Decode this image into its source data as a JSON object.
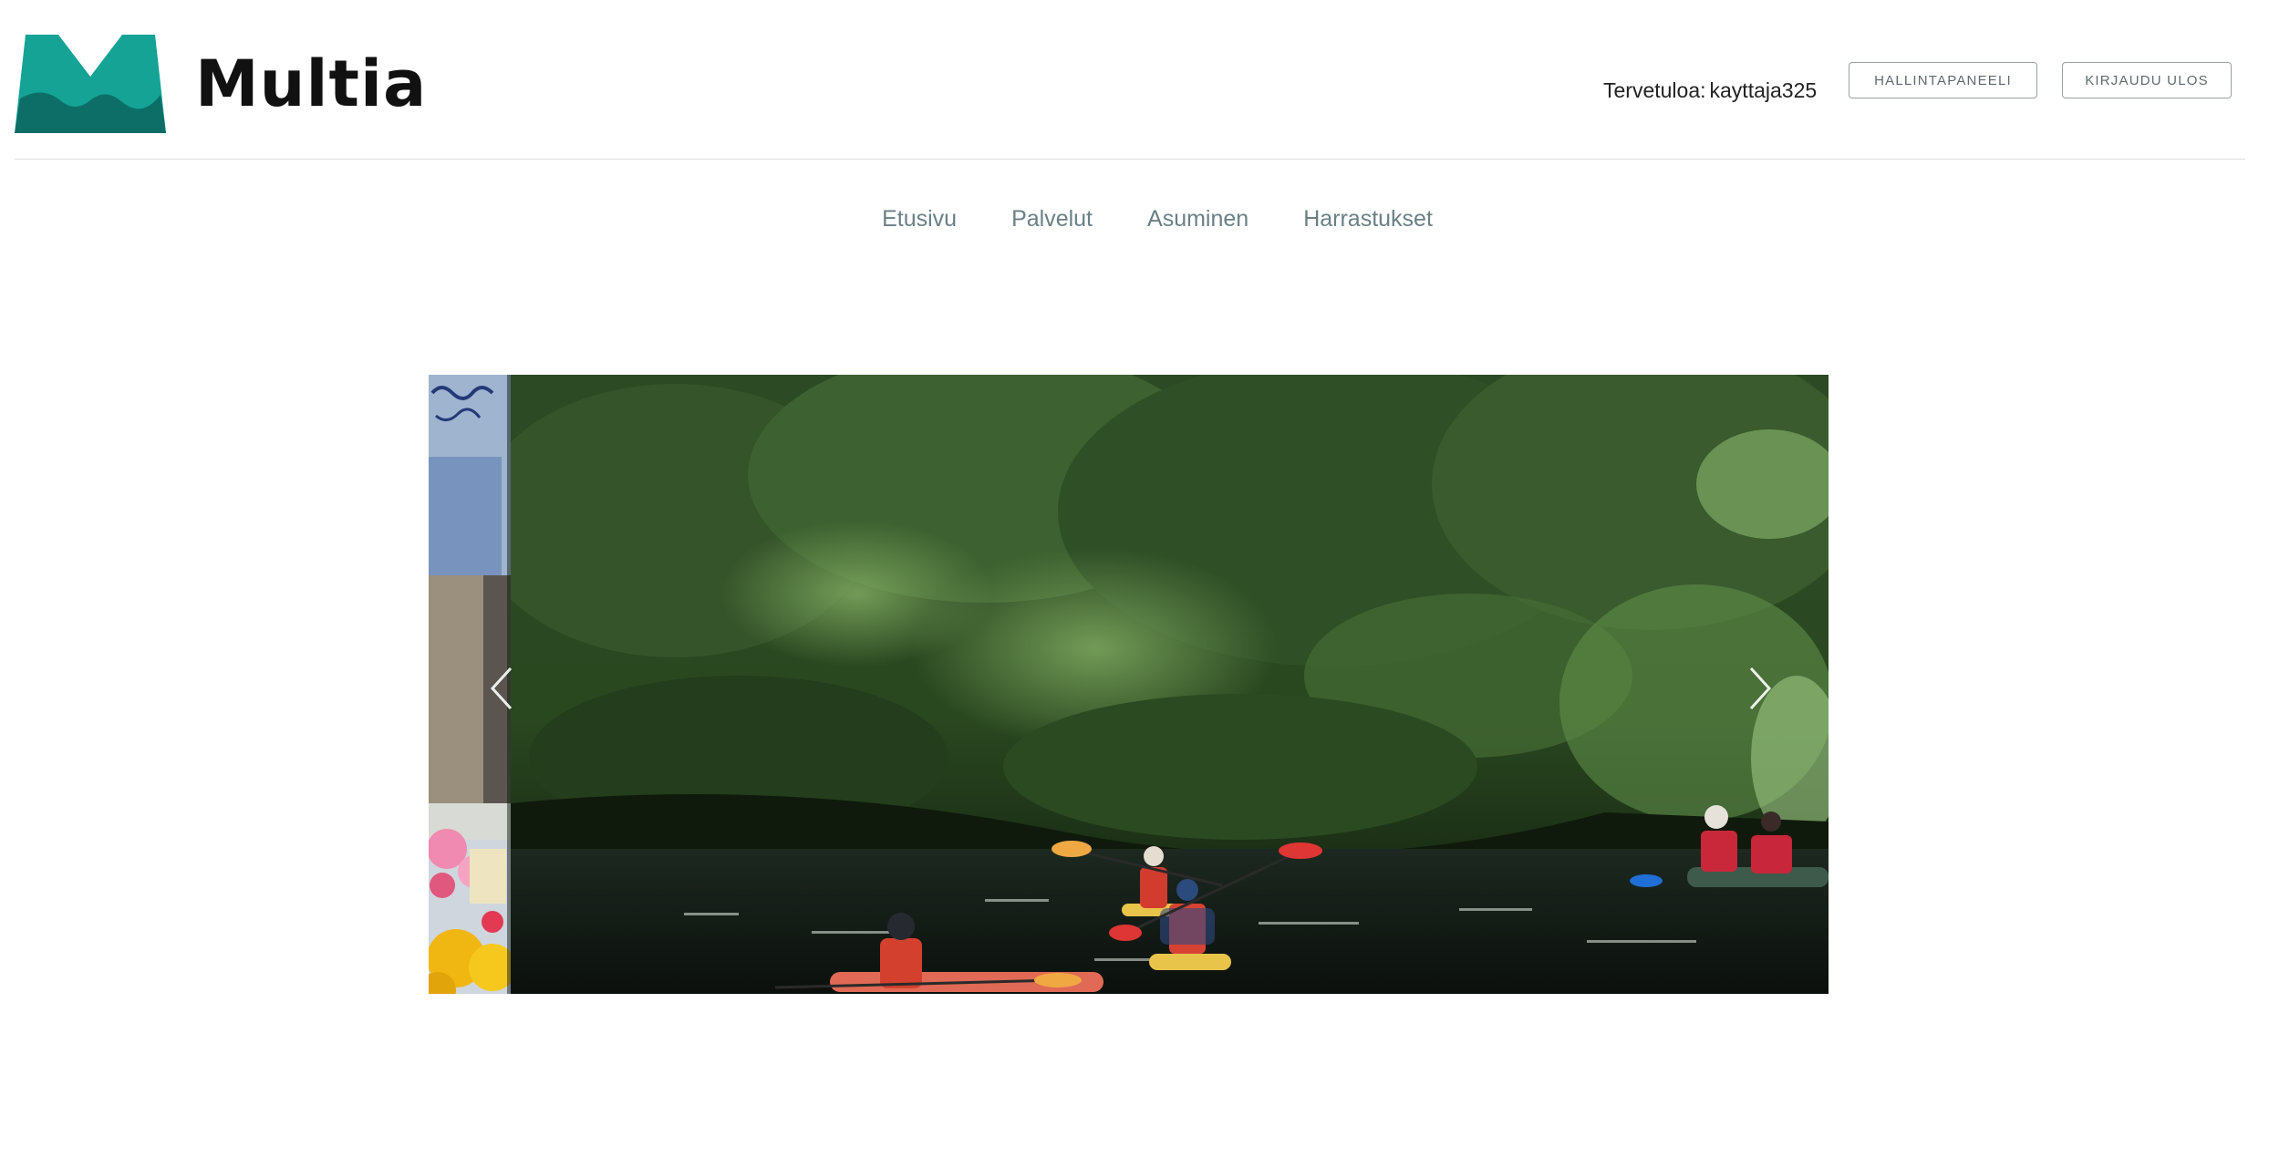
{
  "header": {
    "logo_text": "Multia",
    "welcome_label": "Tervetuloa:",
    "username": "kayttaja325",
    "dashboard_button": "HALLINTAPANEELI",
    "logout_button": "KIRJAUDU ULOS"
  },
  "nav": {
    "items": [
      {
        "label": "Etusivu"
      },
      {
        "label": "Palvelut"
      },
      {
        "label": "Asuminen"
      },
      {
        "label": "Harrastukset"
      }
    ]
  },
  "carousel": {
    "prev_icon": "chevron-left-icon",
    "next_icon": "chevron-right-icon",
    "slides": [
      {
        "image": "market-flowers-photo"
      },
      {
        "image": "river-kayaking-photo"
      }
    ]
  },
  "colors": {
    "brand_teal": "#14a394",
    "brand_dark_teal": "#0d6e68",
    "nav_text": "#6a8086",
    "button_border": "#9aa0a3"
  }
}
